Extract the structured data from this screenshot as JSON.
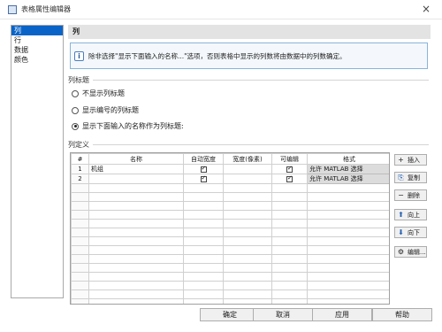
{
  "window": {
    "title": "表格属性编辑器",
    "close_symbol": "×"
  },
  "sidebar": {
    "items": [
      "列",
      "行",
      "数据",
      "颜色"
    ],
    "selected": 0
  },
  "section": {
    "title": "列"
  },
  "info": {
    "icon": "i",
    "text": "除非选择\"显示下面输入的名称...\"选项，否则表格中显示的列数将由数据中的列数确定。"
  },
  "column_headers_group": {
    "title": "列标题",
    "options": [
      {
        "label": "不显示列标题",
        "checked": false
      },
      {
        "label": "显示编号的列标题",
        "checked": false
      },
      {
        "label": "显示下面输入的名称作为列标题:",
        "checked": true
      }
    ]
  },
  "column_definition": {
    "title": "列定义",
    "headers": [
      "#",
      "名称",
      "自动宽度",
      "宽度(像素)",
      "可编辑",
      "格式"
    ],
    "rows": [
      {
        "num": "1",
        "name": "机组",
        "auto_width": true,
        "width": "",
        "editable": true,
        "format": "允许 MATLAB 选择"
      },
      {
        "num": "2",
        "name": "",
        "auto_width": true,
        "width": "",
        "editable": true,
        "format": "允许 MATLAB 选择"
      }
    ]
  },
  "side_buttons": {
    "insert": "插入",
    "copy": "复制",
    "delete": "删除",
    "move_up": "向上",
    "move_down": "向下",
    "edit": "编辑..."
  },
  "footer": {
    "ok": "确定",
    "cancel": "取消",
    "apply": "应用",
    "help": "帮助"
  },
  "icons": {
    "plus": "+",
    "copy": "⎘",
    "minus": "−",
    "up": "⬆",
    "down": "⬇",
    "edit": "⚙"
  }
}
